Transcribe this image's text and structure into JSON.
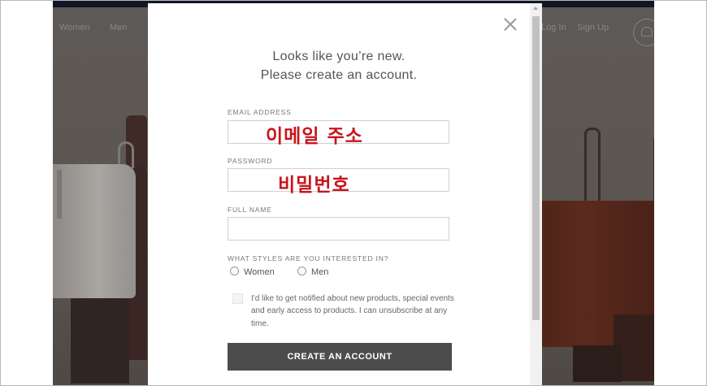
{
  "background_site": {
    "nav": {
      "women": "Women",
      "men": "Men",
      "login": "Log In",
      "signup": "Sign Up"
    }
  },
  "modal": {
    "heading_line1": "Looks like you’re new.",
    "heading_line2": "Please create an account.",
    "email": {
      "label": "EMAIL ADDRESS",
      "value": "",
      "overlay": "이메일 주소"
    },
    "password": {
      "label": "PASSWORD",
      "value": "",
      "overlay": "비밀번호"
    },
    "full_name": {
      "label": "FULL NAME",
      "value": ""
    },
    "styles": {
      "label": "WHAT STYLES ARE YOU INTERESTED IN?",
      "options": [
        "Women",
        "Men"
      ]
    },
    "notify_text": "I'd like to get notified about new products, special events and early access to products. I can unsubscribe at any time.",
    "submit_label": "CREATE AN ACCOUNT",
    "close_icon": "close-icon"
  },
  "colors": {
    "overlay_text": "#c8151c",
    "button_bg": "#4c4c4c",
    "top_bar": "#101626"
  }
}
